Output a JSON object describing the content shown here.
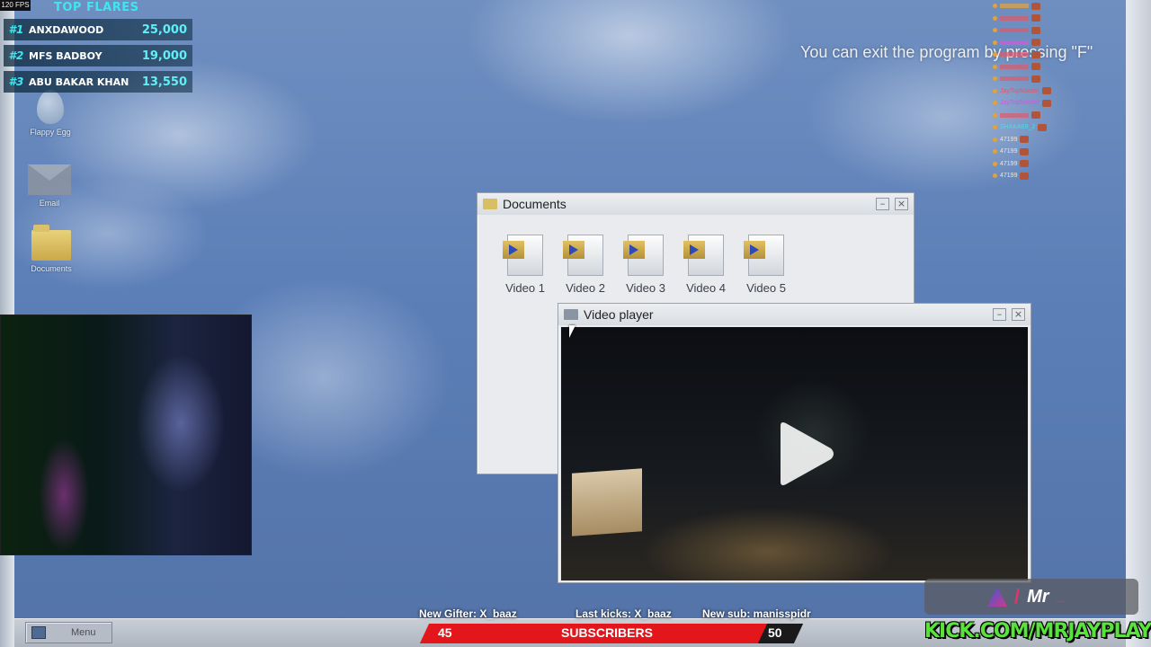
{
  "overlay": {
    "fps": "120 FPS",
    "top_flares": {
      "title": "TOP FLARES",
      "rows": [
        {
          "rank": "#1",
          "name": "ANXDAWOOD",
          "amount": "25,000"
        },
        {
          "rank": "#2",
          "name": "MFS BADBOY",
          "amount": "19,000"
        },
        {
          "rank": "#3",
          "name": "ABU BAKAR KHAN",
          "amount": "13,550"
        }
      ]
    },
    "chat": [
      {
        "user": "",
        "color": "#e8a23a"
      },
      {
        "user": "",
        "color": "#e05a6a"
      },
      {
        "user": "",
        "color": "#e05a6a"
      },
      {
        "user": "",
        "color": "#d15ad8"
      },
      {
        "user": "",
        "color": "#e05a6a"
      },
      {
        "user": "",
        "color": "#e05a6a"
      },
      {
        "user": "",
        "color": "#e05a6a"
      },
      {
        "user": "JayTopMaster",
        "color": "#e05a6a"
      },
      {
        "user": "JayTopMaster",
        "color": "#d05ad8"
      },
      {
        "user": "",
        "color": "#e05a6a"
      },
      {
        "user": "SHAKA69_2",
        "color": "#50d8e8"
      },
      {
        "user": "47199",
        "color": "#e6e6e6"
      },
      {
        "user": "47199",
        "color": "#e6e6e6"
      },
      {
        "user": "47199",
        "color": "#e6e6e6"
      },
      {
        "user": "47199",
        "color": "#e6e6e6"
      }
    ],
    "ticker": {
      "gifter": "New Gifter: X_baaz",
      "kicks": "Last kicks: X_baaz",
      "sub": "New sub: manisspidr"
    },
    "subscribers": {
      "current": "45",
      "label": "SUBSCRIBERS",
      "goal": "50",
      "progress": 0.9
    },
    "brand_text": "Mr",
    "kick_url": "KICK.COM/MRJAYPLAYS"
  },
  "desktop": {
    "exit_message": "You can exit the program by pressing \"F\"",
    "icons": [
      {
        "label": "Flappy Egg",
        "icon": "egg-icon"
      },
      {
        "label": "Email",
        "icon": "envelope-icon"
      },
      {
        "label": "Documents",
        "icon": "folder-icon"
      }
    ],
    "taskbar": {
      "menu_label": "Menu"
    }
  },
  "documents_window": {
    "title": "Documents",
    "files": [
      {
        "label": "Video 1"
      },
      {
        "label": "Video 2"
      },
      {
        "label": "Video 3"
      },
      {
        "label": "Video 4"
      },
      {
        "label": "Video 5"
      }
    ]
  },
  "player_window": {
    "title": "Video player"
  },
  "colors": {
    "flare_accent": "#3fe6f0",
    "sub_bar": "#e3171b",
    "kick_green": "#59e13c"
  }
}
